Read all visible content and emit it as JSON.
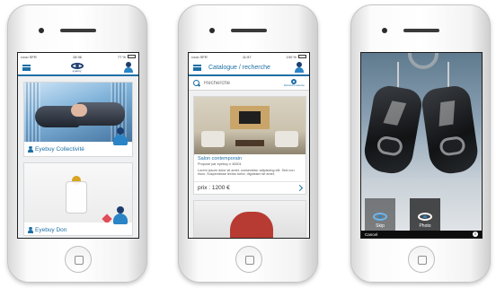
{
  "phone1": {
    "status": {
      "carrier": "•••oo SFR",
      "time": "15:36",
      "battery": "77 %"
    },
    "logo_text": "eyebuy",
    "cards": [
      {
        "label": "Eyebuy Collectivité"
      },
      {
        "label": "Eyebuy Don"
      }
    ]
  },
  "phone2": {
    "status": {
      "carrier": "•••oo SFR",
      "time": "11:57",
      "battery": "100 %"
    },
    "title": "Catalogue / recherche",
    "search": {
      "placeholder": "Recherche"
    },
    "advanced_label": "Recherche avancée",
    "product": {
      "name": "Salon contemporain",
      "subtitle": "Proposé par eyebuy n 46301",
      "description": "Lorem ipsum dolor sit amet, consectetur adipiscing elit. Sed non risus. Suspendisse lectus tortor, dignissim sit amet,",
      "price": "prix : 1200 €"
    }
  },
  "phone3": {
    "tools": {
      "skip": "Skip",
      "photo": "Photo"
    },
    "cancel": "Cancel",
    "info": "i"
  }
}
